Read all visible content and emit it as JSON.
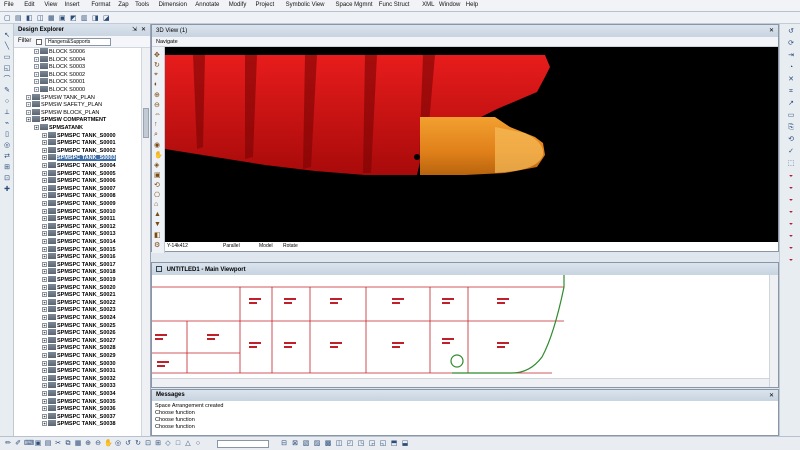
{
  "menu": [
    "File",
    "Edit",
    "View",
    "Insert",
    "Format",
    "Zap",
    "Tools",
    "Dimension",
    "Annotate",
    "Modify",
    "Project",
    "Symbolic View",
    "Space Mgmnt",
    "Func Struct",
    "XML",
    "Window",
    "Help"
  ],
  "explorer": {
    "title": "Design Explorer",
    "pin": "⇲",
    "close": "✕",
    "filter_label": "Filter",
    "filter_value": "Hangers&Supports"
  },
  "tree": [
    {
      "label": "BLOCK S0006",
      "indent": 2,
      "bold": false
    },
    {
      "label": "BLOCK S0004",
      "indent": 2,
      "bold": false
    },
    {
      "label": "BLOCK S0003",
      "indent": 2,
      "bold": false
    },
    {
      "label": "BLOCK S0002",
      "indent": 2,
      "bold": false
    },
    {
      "label": "BLOCK S0001",
      "indent": 2,
      "bold": false
    },
    {
      "label": "BLOCK S0000",
      "indent": 2,
      "bold": false
    },
    {
      "label": "SPMSW TANK_PLAN",
      "indent": 1,
      "bold": false
    },
    {
      "label": "SPMSW SAFETY_PLAN",
      "indent": 1,
      "bold": false
    },
    {
      "label": "SPMSW BLOCK_PLAN",
      "indent": 1,
      "bold": false
    },
    {
      "label": "SPMSW COMPARTMENT",
      "indent": 1,
      "bold": true
    },
    {
      "label": "SPMSATANK",
      "indent": 2,
      "bold": true
    },
    {
      "label": "SPMSPC TANK_S0000",
      "indent": 3,
      "bold": true
    },
    {
      "label": "SPMSPC TANK_S0001",
      "indent": 3,
      "bold": true
    },
    {
      "label": "SPMSPC TANK_S0002",
      "indent": 3,
      "bold": true
    },
    {
      "label": "SPMSPC TANK_S0003",
      "indent": 3,
      "bold": true,
      "selected": true
    },
    {
      "label": "SPMSPC TANK_S0004",
      "indent": 3,
      "bold": true
    },
    {
      "label": "SPMSPC TANK_S0005",
      "indent": 3,
      "bold": true
    },
    {
      "label": "SPMSPC TANK_S0006",
      "indent": 3,
      "bold": true
    },
    {
      "label": "SPMSPC TANK_S0007",
      "indent": 3,
      "bold": true
    },
    {
      "label": "SPMSPC TANK_S0008",
      "indent": 3,
      "bold": true
    },
    {
      "label": "SPMSPC TANK_S0009",
      "indent": 3,
      "bold": true
    },
    {
      "label": "SPMSPC TANK_S0010",
      "indent": 3,
      "bold": true
    },
    {
      "label": "SPMSPC TANK_S0011",
      "indent": 3,
      "bold": true
    },
    {
      "label": "SPMSPC TANK_S0012",
      "indent": 3,
      "bold": true
    },
    {
      "label": "SPMSPC TANK_S0013",
      "indent": 3,
      "bold": true
    },
    {
      "label": "SPMSPC TANK_S0014",
      "indent": 3,
      "bold": true
    },
    {
      "label": "SPMSPC TANK_S0015",
      "indent": 3,
      "bold": true
    },
    {
      "label": "SPMSPC TANK_S0016",
      "indent": 3,
      "bold": true
    },
    {
      "label": "SPMSPC TANK_S0017",
      "indent": 3,
      "bold": true
    },
    {
      "label": "SPMSPC TANK_S0018",
      "indent": 3,
      "bold": true
    },
    {
      "label": "SPMSPC TANK_S0019",
      "indent": 3,
      "bold": true
    },
    {
      "label": "SPMSPC TANK_S0020",
      "indent": 3,
      "bold": true
    },
    {
      "label": "SPMSPC TANK_S0021",
      "indent": 3,
      "bold": true
    },
    {
      "label": "SPMSPC TANK_S0022",
      "indent": 3,
      "bold": true
    },
    {
      "label": "SPMSPC TANK_S0023",
      "indent": 3,
      "bold": true
    },
    {
      "label": "SPMSPC TANK_S0024",
      "indent": 3,
      "bold": true
    },
    {
      "label": "SPMSPC TANK_S0025",
      "indent": 3,
      "bold": true
    },
    {
      "label": "SPMSPC TANK_S0026",
      "indent": 3,
      "bold": true
    },
    {
      "label": "SPMSPC TANK_S0027",
      "indent": 3,
      "bold": true
    },
    {
      "label": "SPMSPC TANK_S0028",
      "indent": 3,
      "bold": true
    },
    {
      "label": "SPMSPC TANK_S0029",
      "indent": 3,
      "bold": true
    },
    {
      "label": "SPMSPC TANK_S0030",
      "indent": 3,
      "bold": true
    },
    {
      "label": "SPMSPC TANK_S0031",
      "indent": 3,
      "bold": true
    },
    {
      "label": "SPMSPC TANK_S0032",
      "indent": 3,
      "bold": true
    },
    {
      "label": "SPMSPC TANK_S0033",
      "indent": 3,
      "bold": true
    },
    {
      "label": "SPMSPC TANK_S0034",
      "indent": 3,
      "bold": true
    },
    {
      "label": "SPMSPC TANK_S0035",
      "indent": 3,
      "bold": true
    },
    {
      "label": "SPMSPC TANK_S0036",
      "indent": 3,
      "bold": true
    },
    {
      "label": "SPMSPC TANK_S0037",
      "indent": 3,
      "bold": true
    },
    {
      "label": "SPMSPC TANK_S0038",
      "indent": 3,
      "bold": true
    }
  ],
  "view3d": {
    "title": "3D View (1)",
    "nav": "Navigate",
    "status_coords": "Y-14k412",
    "status_projection": "Parallel",
    "status_mode": "Model",
    "status_action": "Rotate"
  },
  "viewport": {
    "title": "UNTITLED1 - Main Viewport"
  },
  "messages": {
    "title": "Messages",
    "lines": [
      "Space Arrangement created",
      "Choose function",
      "Choose function",
      "Choose function"
    ]
  },
  "colors": {
    "hull_red": "#cc1010",
    "bow_orange": "#e88a10",
    "plan_line": "#c0202a",
    "hull_outline": "#2e8b2e"
  }
}
